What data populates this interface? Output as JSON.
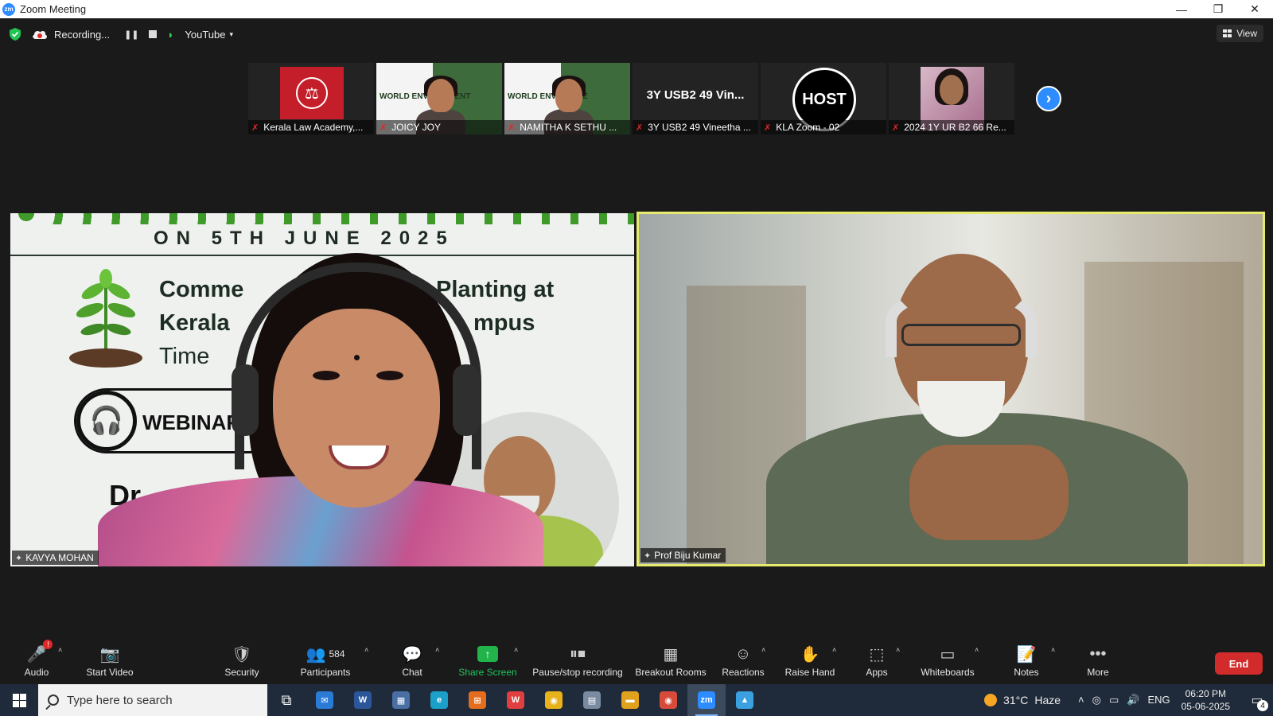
{
  "window": {
    "title": "Zoom Meeting",
    "minimize": "—",
    "restore": "❐",
    "close": "✕"
  },
  "topbar": {
    "recording_label": "Recording...",
    "pause_glyph": "❚❚",
    "stream_glyph": "◗",
    "stream_target": "YouTube",
    "caret": "▾",
    "view_label": "View"
  },
  "thumbnails": [
    {
      "name": "Kerala Law Academy,...",
      "kind": "logo"
    },
    {
      "name": "JOICY JOY",
      "kind": "poster",
      "poster_text": "WORLD ENVIRONMENT"
    },
    {
      "name": "NAMITHA K SETHU ...",
      "kind": "poster",
      "poster_text": "WORLD ENVIRONME"
    },
    {
      "name": "3Y USB2 49 Vineetha ...",
      "kind": "text",
      "display_text": "3Y USB2 49 Vin..."
    },
    {
      "name": "KLA Zoom - 02",
      "kind": "host",
      "display_text": "HOST"
    },
    {
      "name": "2024 1Y UR B2 66 Re...",
      "kind": "photo"
    }
  ],
  "next_page_glyph": "›",
  "mic_off_glyph": "✗",
  "pin_glyph": "✦",
  "main_tiles": {
    "left": {
      "name": "KAVYA MOHAN",
      "poster": {
        "date_line": "ON 5TH JUNE 2025",
        "title_line1_a": "Comme",
        "title_line1_b": "Planting at",
        "title_line2_a": "Kerala",
        "title_line2_b": "mpus",
        "time_label": "Time",
        "badge_label": "WEBINAR",
        "headset_glyph": "🎧",
        "speaker_prefix": "Dr"
      }
    },
    "right": {
      "name": "Prof Biju Kumar"
    }
  },
  "toolbar": {
    "audio": {
      "label": "Audio",
      "icon": "🎤",
      "alert": "!"
    },
    "video": {
      "label": "Start Video",
      "icon": "📷"
    },
    "security": {
      "label": "Security",
      "icon": "🛡"
    },
    "participants": {
      "label": "Participants",
      "icon": "👥",
      "count": "584"
    },
    "chat": {
      "label": "Chat",
      "icon": "💬"
    },
    "share": {
      "label": "Share Screen",
      "icon": "↑"
    },
    "recording": {
      "label": "Pause/stop recording",
      "icon": "⏸⏹"
    },
    "breakout": {
      "label": "Breakout Rooms",
      "icon": "▦"
    },
    "reactions": {
      "label": "Reactions",
      "icon": "☺"
    },
    "raise_hand": {
      "label": "Raise Hand",
      "icon": "✋"
    },
    "apps": {
      "label": "Apps",
      "icon": "⬚"
    },
    "whiteboards": {
      "label": "Whiteboards",
      "icon": "▭"
    },
    "notes": {
      "label": "Notes",
      "icon": "📝"
    },
    "more": {
      "label": "More",
      "icon": "•••"
    },
    "end": {
      "label": "End"
    },
    "caret": "˄"
  },
  "taskbar": {
    "search_placeholder": "Type here to search",
    "task_view_glyph": "⧉",
    "apps": [
      {
        "name": "mail",
        "glyph": "✉",
        "color": "#2a7bd5"
      },
      {
        "name": "word",
        "glyph": "W",
        "color": "#2b579a"
      },
      {
        "name": "calculator",
        "glyph": "▦",
        "color": "#4a6fa5"
      },
      {
        "name": "edge",
        "glyph": "e",
        "color": "#1ba0c9"
      },
      {
        "name": "store",
        "glyph": "⊞",
        "color": "#e46e1e"
      },
      {
        "name": "wps",
        "glyph": "W",
        "color": "#e13f3f"
      },
      {
        "name": "chrome",
        "glyph": "◉",
        "color": "#e8b21b"
      },
      {
        "name": "files",
        "glyph": "▤",
        "color": "#7a8aa0"
      },
      {
        "name": "explorer",
        "glyph": "▬",
        "color": "#e0a21c"
      },
      {
        "name": "chrome-profile",
        "glyph": "◉",
        "color": "#d84b3a"
      },
      {
        "name": "zoom",
        "glyph": "zm",
        "color": "#2d8cff"
      },
      {
        "name": "photos",
        "glyph": "▲",
        "color": "#3aa0e0"
      }
    ],
    "weather": {
      "temp": "31°C",
      "condition": "Haze",
      "alert_count": "1"
    },
    "tray_up_glyph": "˄",
    "tray_meet_glyph": "◎",
    "tray_network_glyph": "▭",
    "tray_volume_glyph": "🔊",
    "language": "ENG",
    "time": "06:20 PM",
    "date": "05-06-2025",
    "notifications_glyph": "▭",
    "notifications": "4"
  }
}
